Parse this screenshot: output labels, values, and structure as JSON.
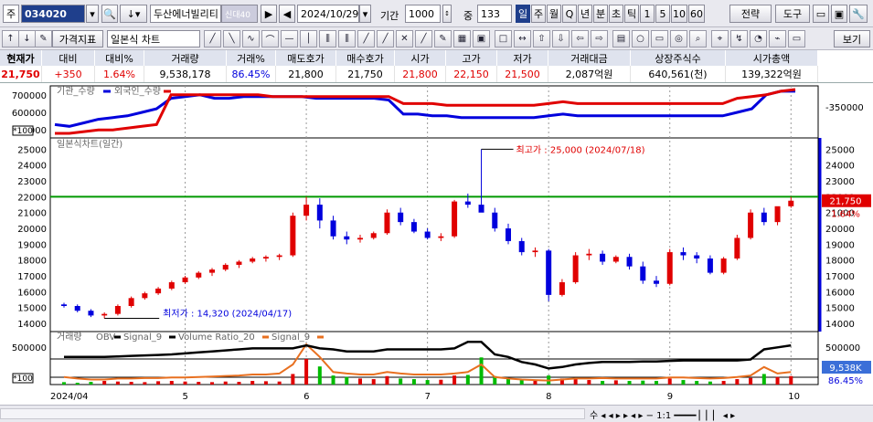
{
  "toolbar": {
    "prefix": "주",
    "code": "034020",
    "name": "두산에너빌리티",
    "name_tag": "신대40",
    "date": "2024/10/29",
    "period_label": "기간",
    "period_value": "1000",
    "mid_label": "중",
    "mid_value": "133",
    "periods": [
      "일",
      "주",
      "월",
      "Q",
      "년",
      "분",
      "초",
      "틱",
      "1",
      "5",
      "10",
      "60"
    ],
    "strategy": "전략",
    "tools": "도구",
    "price_indicator": "가격지표",
    "chart_type": "일본식 차트",
    "view": "보기"
  },
  "quote": {
    "headers": [
      "현재가",
      "대비",
      "대비%",
      "거래량",
      "거래%",
      "매도호가",
      "매수호가",
      "시가",
      "고가",
      "저가",
      "거래대금",
      "상장주식수",
      "시가총액"
    ],
    "values": [
      "21,750",
      "+350",
      "1.64%",
      "9,538,178",
      "86.45%",
      "21,800",
      "21,750",
      "21,800",
      "22,150",
      "21,500",
      "2,087억원",
      "640,561(천)",
      "139,322억원"
    ]
  },
  "colors": {
    "up": "#e00000",
    "down": "#0000dd",
    "hline": "#009900",
    "obv": "#000000",
    "vr": "#e87020"
  },
  "chart_data": [
    {
      "type": "line",
      "title": "기관_수량",
      "series": [
        {
          "name": "기관_수량",
          "color": "#0000dd",
          "values": [
            530000,
            520000,
            540000,
            560000,
            570000,
            580000,
            600000,
            620000,
            680000,
            690000,
            700000,
            680000,
            680000,
            690000,
            690000,
            690000,
            690000,
            690000,
            680000,
            680000,
            680000,
            680000,
            680000,
            670000,
            590000,
            590000,
            580000,
            580000,
            570000,
            570000,
            570000,
            570000,
            570000,
            570000,
            580000,
            590000,
            580000,
            580000,
            580000,
            580000,
            580000,
            580000,
            580000,
            580000,
            580000,
            580000,
            580000,
            600000,
            620000,
            700000,
            720000,
            720000
          ]
        },
        {
          "name": "외국인_수량",
          "color": "#e00000",
          "values": [
            480000,
            480000,
            490000,
            500000,
            500000,
            510000,
            520000,
            530000,
            700000,
            700000,
            700000,
            700000,
            700000,
            700000,
            700000,
            690000,
            690000,
            690000,
            690000,
            690000,
            690000,
            690000,
            690000,
            690000,
            650000,
            650000,
            650000,
            640000,
            640000,
            640000,
            640000,
            640000,
            640000,
            640000,
            650000,
            660000,
            650000,
            650000,
            650000,
            650000,
            650000,
            650000,
            650000,
            650000,
            650000,
            650000,
            650000,
            680000,
            690000,
            700000,
            720000,
            730000
          ]
        }
      ],
      "y_ticks": [
        500000,
        600000,
        700000
      ],
      "right_ticks": [
        "-350000"
      ],
      "scale_label": "*100"
    },
    {
      "type": "candlestick",
      "title": "일본식차트(일간)",
      "y_ticks": [
        14000,
        15000,
        16000,
        17000,
        18000,
        19000,
        20000,
        21000,
        22000,
        23000,
        24000,
        25000
      ],
      "hline": 22000,
      "last_label": "21,750",
      "last_pct": "1.64%",
      "high_note": "최고가 : 25,000 (2024/07/18)",
      "low_note": "최저가 : 14,320 (2024/04/17)",
      "x_labels": [
        "2024/04",
        "5",
        "6",
        "7",
        "8",
        "9",
        "10"
      ],
      "candles": [
        [
          15200,
          15300,
          15000,
          15100
        ],
        [
          15100,
          15200,
          14700,
          14800
        ],
        [
          14800,
          14900,
          14400,
          14500
        ],
        [
          14500,
          14700,
          14320,
          14600
        ],
        [
          14600,
          15200,
          14500,
          15100
        ],
        [
          15100,
          15700,
          15000,
          15600
        ],
        [
          15600,
          16000,
          15500,
          15900
        ],
        [
          15900,
          16300,
          15800,
          16200
        ],
        [
          16200,
          16700,
          16100,
          16600
        ],
        [
          16600,
          17000,
          16500,
          16900
        ],
        [
          16900,
          17300,
          16800,
          17200
        ],
        [
          17200,
          17500,
          17000,
          17400
        ],
        [
          17400,
          17800,
          17300,
          17700
        ],
        [
          17700,
          18000,
          17500,
          17900
        ],
        [
          17900,
          18200,
          17800,
          18100
        ],
        [
          18100,
          18300,
          17900,
          18200
        ],
        [
          18200,
          18400,
          18000,
          18300
        ],
        [
          18300,
          21000,
          18200,
          20800
        ],
        [
          20800,
          22000,
          20500,
          21500
        ],
        [
          21500,
          21900,
          20000,
          20500
        ],
        [
          20500,
          20800,
          19300,
          19500
        ],
        [
          19500,
          19800,
          19000,
          19300
        ],
        [
          19300,
          19600,
          19100,
          19400
        ],
        [
          19400,
          19800,
          19300,
          19700
        ],
        [
          19700,
          21200,
          19600,
          21000
        ],
        [
          21000,
          21300,
          20200,
          20400
        ],
        [
          20400,
          20600,
          19700,
          19800
        ],
        [
          19800,
          20000,
          19300,
          19400
        ],
        [
          19400,
          19700,
          19200,
          19500
        ],
        [
          19500,
          21800,
          19400,
          21700
        ],
        [
          21700,
          22200,
          21300,
          21500
        ],
        [
          21500,
          25000,
          21200,
          21000
        ],
        [
          21000,
          21300,
          19800,
          20000
        ],
        [
          20000,
          20300,
          19000,
          19200
        ],
        [
          19200,
          19400,
          18300,
          18500
        ],
        [
          18500,
          18800,
          18200,
          18600
        ],
        [
          18600,
          18700,
          15400,
          15800
        ],
        [
          15800,
          16800,
          15700,
          16600
        ],
        [
          16600,
          18500,
          16500,
          18300
        ],
        [
          18300,
          18700,
          18000,
          18400
        ],
        [
          18400,
          18600,
          17700,
          17900
        ],
        [
          17900,
          18300,
          17800,
          18200
        ],
        [
          18200,
          18400,
          17400,
          17600
        ],
        [
          17600,
          17900,
          16500,
          16700
        ],
        [
          16700,
          17000,
          16300,
          16500
        ],
        [
          16500,
          18700,
          16400,
          18500
        ],
        [
          18500,
          18800,
          18000,
          18300
        ],
        [
          18300,
          18500,
          17800,
          18100
        ],
        [
          18100,
          18300,
          17100,
          17200
        ],
        [
          17200,
          18200,
          17100,
          18100
        ],
        [
          18100,
          19600,
          18000,
          19400
        ],
        [
          19400,
          21200,
          19300,
          21000
        ],
        [
          21000,
          21300,
          20200,
          20400
        ],
        [
          20400,
          21300,
          20200,
          21400
        ],
        [
          21400,
          22000,
          21300,
          21750
        ]
      ]
    },
    {
      "type": "bar",
      "title": "거래량",
      "legend": [
        "OBV",
        "Signal_9",
        "Volume Ratio_20",
        "Signal_9"
      ],
      "y_ticks": [
        500000
      ],
      "scale_label": "*100",
      "last_label": "9,538K",
      "last_pct": "86.45%",
      "obv": [
        0.55,
        0.55,
        0.55,
        0.55,
        0.56,
        0.57,
        0.58,
        0.59,
        0.6,
        0.62,
        0.64,
        0.66,
        0.68,
        0.7,
        0.72,
        0.72,
        0.72,
        0.72,
        0.78,
        0.72,
        0.7,
        0.66,
        0.66,
        0.66,
        0.7,
        0.7,
        0.7,
        0.7,
        0.7,
        0.72,
        0.85,
        0.85,
        0.6,
        0.55,
        0.45,
        0.4,
        0.32,
        0.35,
        0.4,
        0.43,
        0.45,
        0.45,
        0.45,
        0.46,
        0.46,
        0.47,
        0.48,
        0.48,
        0.48,
        0.48,
        0.48,
        0.5,
        0.7,
        0.74,
        0.78
      ],
      "vr": [
        0.15,
        0.12,
        0.1,
        0.1,
        0.12,
        0.12,
        0.13,
        0.13,
        0.14,
        0.14,
        0.15,
        0.16,
        0.17,
        0.18,
        0.2,
        0.2,
        0.22,
        0.4,
        0.8,
        0.55,
        0.25,
        0.22,
        0.2,
        0.2,
        0.25,
        0.22,
        0.2,
        0.2,
        0.2,
        0.22,
        0.25,
        0.4,
        0.15,
        0.12,
        0.1,
        0.09,
        0.08,
        0.1,
        0.12,
        0.12,
        0.13,
        0.12,
        0.12,
        0.12,
        0.12,
        0.14,
        0.14,
        0.13,
        0.12,
        0.13,
        0.15,
        0.18,
        0.35,
        0.22,
        0.25
      ],
      "vol": [
        0.08,
        0.06,
        0.09,
        0.12,
        0.1,
        0.09,
        0.08,
        0.11,
        0.12,
        0.1,
        0.09,
        0.08,
        0.1,
        0.09,
        0.12,
        0.11,
        0.1,
        0.35,
        0.85,
        0.6,
        0.3,
        0.25,
        0.2,
        0.18,
        0.28,
        0.2,
        0.18,
        0.15,
        0.16,
        0.3,
        0.32,
        0.9,
        0.28,
        0.2,
        0.18,
        0.15,
        0.3,
        0.2,
        0.22,
        0.15,
        0.12,
        0.14,
        0.12,
        0.13,
        0.12,
        0.2,
        0.15,
        0.12,
        0.1,
        0.12,
        0.18,
        0.22,
        0.35,
        0.25,
        0.28
      ]
    }
  ]
}
